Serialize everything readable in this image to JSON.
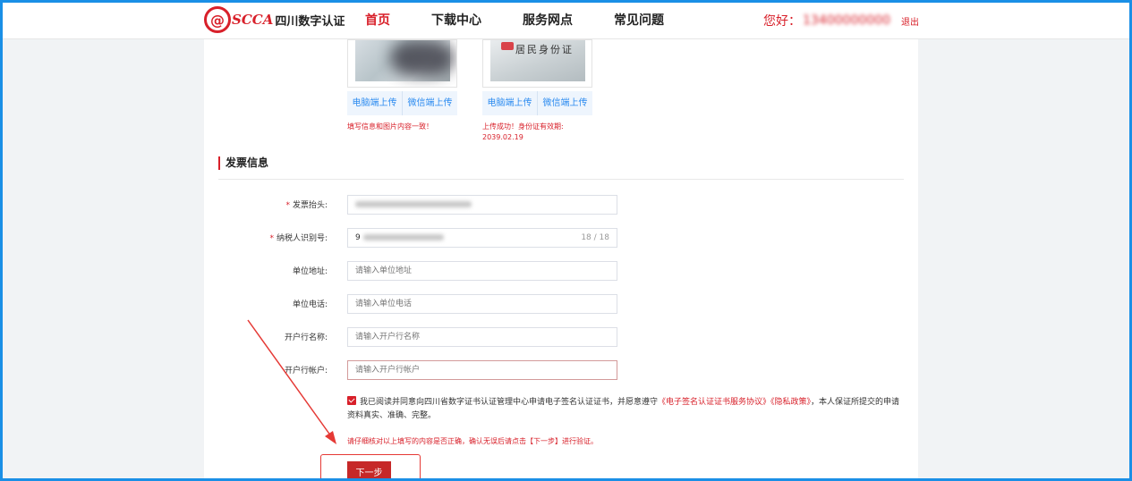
{
  "header": {
    "logo_mark": "@",
    "logo_brand": "SCCA",
    "logo_cn": "四川数字认证",
    "nav": [
      "首页",
      "下载中心",
      "服务网点",
      "常见问题"
    ],
    "greeting": "您好：",
    "phone": "13400000000",
    "logout": "退出"
  },
  "id_upload": [
    {
      "pc_upload": "电脑端上传",
      "wechat_upload": "微信端上传",
      "hint": "填写信息和图片内容一致！"
    },
    {
      "card_title": "居民身份证",
      "pc_upload": "电脑端上传",
      "wechat_upload": "微信端上传",
      "hint_line1": "上传成功！身份证有效期:",
      "hint_line2": "2039.02.19"
    }
  ],
  "invoice": {
    "section_title": "发票信息",
    "fields": [
      {
        "label": "发票抬头:",
        "required": true,
        "value": "四川某某电子商务有限公司",
        "placeholder": ""
      },
      {
        "label": "纳税人识别号:",
        "required": true,
        "value": "9",
        "placeholder": "",
        "count": "18 / 18"
      },
      {
        "label": "单位地址:",
        "required": false,
        "value": "",
        "placeholder": "请输入单位地址"
      },
      {
        "label": "单位电话:",
        "required": false,
        "value": "",
        "placeholder": "请输入单位电话"
      },
      {
        "label": "开户行名称:",
        "required": false,
        "value": "",
        "placeholder": "请输入开户行名称"
      },
      {
        "label": "开户行帐户:",
        "required": false,
        "value": "",
        "placeholder": "请输入开户行帐户"
      }
    ]
  },
  "agreement": {
    "text1": "我已阅读并同意向四川省数字证书认证管理中心申请电子签名认证证书，并愿意遵守",
    "link1": "《电子签名认证证书服务协议》",
    "link2": "《隐私政策》",
    "text2": "，本人保证所提交的申请资料真实、准确、完整。"
  },
  "notice": "请仔细核对以上填写的内容是否正确，确认无误后请点击【下一步】进行验证。",
  "next_button": "下一步",
  "colors": {
    "brand_red": "#d8202a",
    "link_blue": "#2d8cf0",
    "frame_blue": "#1a8fe6"
  }
}
